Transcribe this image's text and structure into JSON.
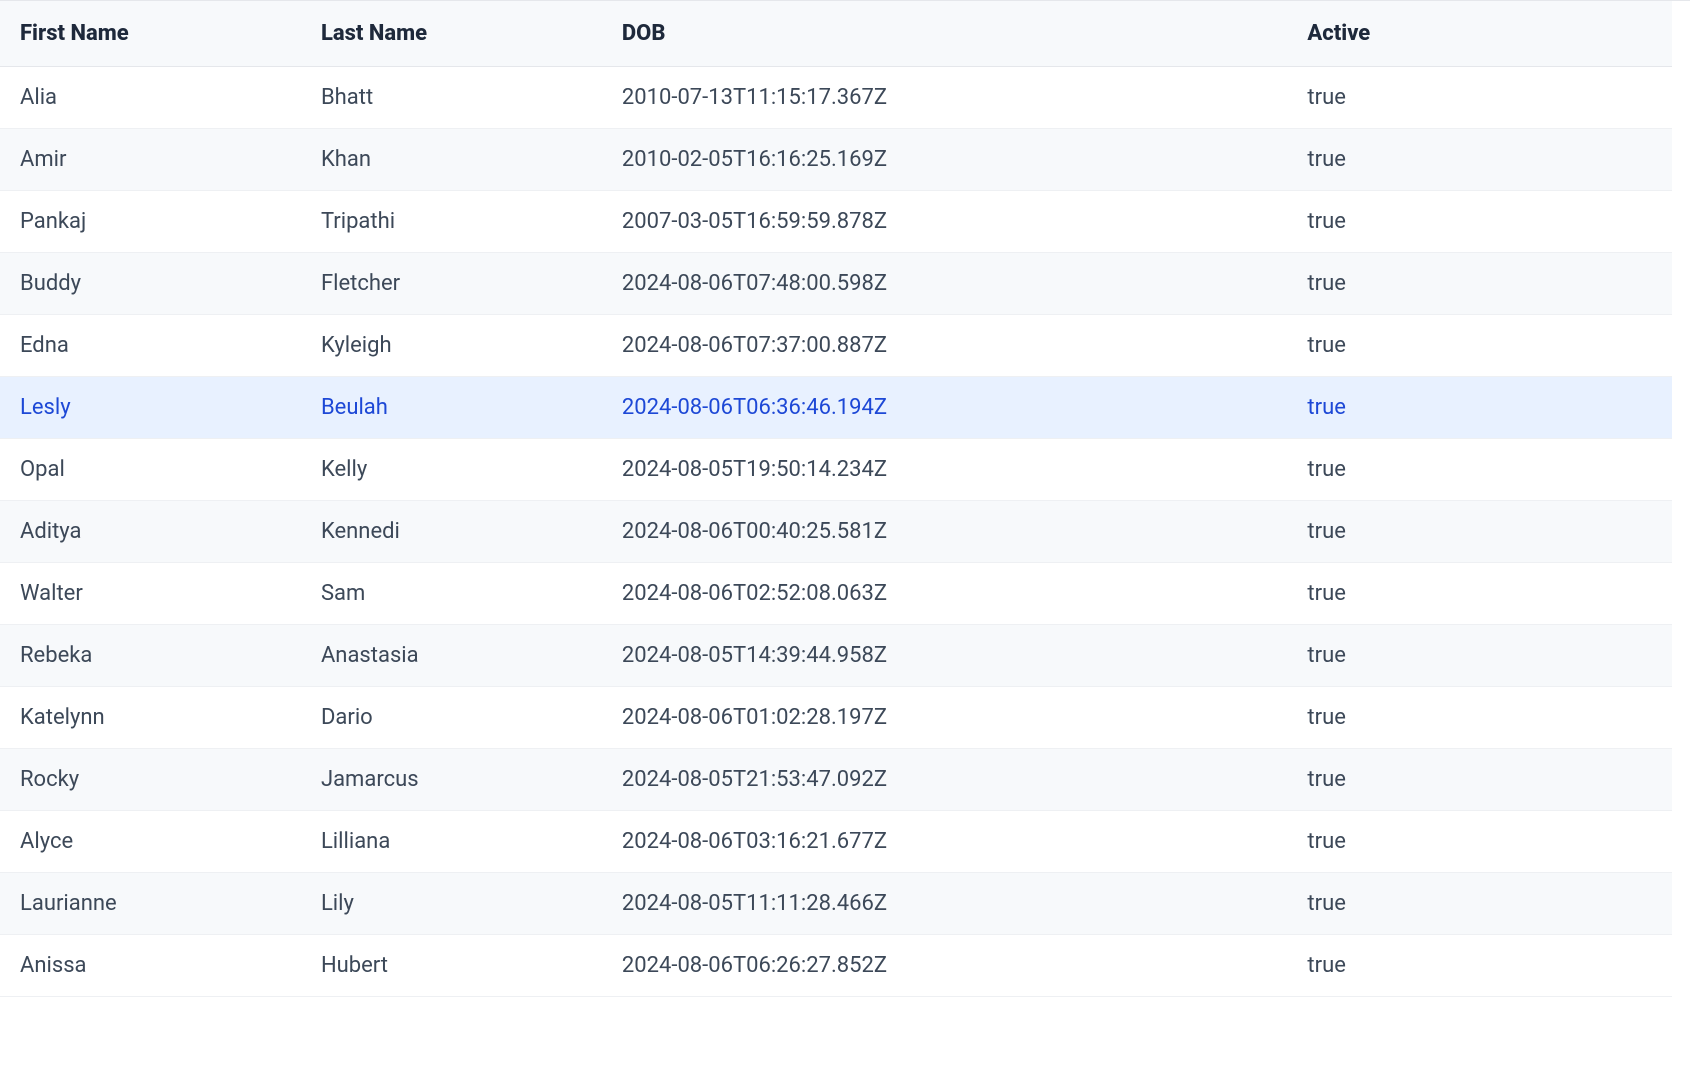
{
  "table": {
    "headers": {
      "first_name": "First Name",
      "last_name": "Last Name",
      "dob": "DOB",
      "active": "Active"
    },
    "selected_index": 5,
    "rows": [
      {
        "first_name": "Alia",
        "last_name": "Bhatt",
        "dob": "2010-07-13T11:15:17.367Z",
        "active": "true"
      },
      {
        "first_name": "Amir",
        "last_name": "Khan",
        "dob": "2010-02-05T16:16:25.169Z",
        "active": "true"
      },
      {
        "first_name": "Pankaj",
        "last_name": "Tripathi",
        "dob": "2007-03-05T16:59:59.878Z",
        "active": "true"
      },
      {
        "first_name": "Buddy",
        "last_name": "Fletcher",
        "dob": "2024-08-06T07:48:00.598Z",
        "active": "true"
      },
      {
        "first_name": "Edna",
        "last_name": "Kyleigh",
        "dob": "2024-08-06T07:37:00.887Z",
        "active": "true"
      },
      {
        "first_name": "Lesly",
        "last_name": "Beulah",
        "dob": "2024-08-06T06:36:46.194Z",
        "active": "true"
      },
      {
        "first_name": "Opal",
        "last_name": "Kelly",
        "dob": "2024-08-05T19:50:14.234Z",
        "active": "true"
      },
      {
        "first_name": "Aditya",
        "last_name": "Kennedi",
        "dob": "2024-08-06T00:40:25.581Z",
        "active": "true"
      },
      {
        "first_name": "Walter",
        "last_name": "Sam",
        "dob": "2024-08-06T02:52:08.063Z",
        "active": "true"
      },
      {
        "first_name": "Rebeka",
        "last_name": "Anastasia",
        "dob": "2024-08-05T14:39:44.958Z",
        "active": "true"
      },
      {
        "first_name": "Katelynn",
        "last_name": "Dario",
        "dob": "2024-08-06T01:02:28.197Z",
        "active": "true"
      },
      {
        "first_name": "Rocky",
        "last_name": "Jamarcus",
        "dob": "2024-08-05T21:53:47.092Z",
        "active": "true"
      },
      {
        "first_name": "Alyce",
        "last_name": "Lilliana",
        "dob": "2024-08-06T03:16:21.677Z",
        "active": "true"
      },
      {
        "first_name": "Laurianne",
        "last_name": "Lily",
        "dob": "2024-08-05T11:11:28.466Z",
        "active": "true"
      },
      {
        "first_name": "Anissa",
        "last_name": "Hubert",
        "dob": "2024-08-06T06:26:27.852Z",
        "active": "true"
      }
    ]
  }
}
